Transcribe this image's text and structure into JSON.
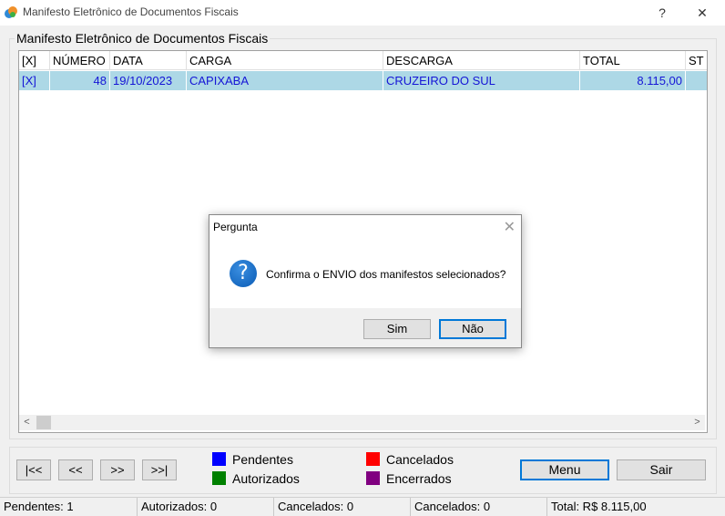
{
  "window": {
    "title": "Manifesto Eletrônico de Documentos Fiscais",
    "help_glyph": "?",
    "close_glyph": "✕"
  },
  "group": {
    "legend": "Manifesto Eletrônico de Documentos Fiscais"
  },
  "grid": {
    "columns": [
      "[X]",
      "NÚMERO",
      "DATA",
      "CARGA",
      "DESCARGA",
      "TOTAL",
      "ST"
    ],
    "rows": [
      {
        "sel": "[X]",
        "numero": "48",
        "data": "19/10/2023",
        "carga": "CAPIXABA",
        "descarga": "CRUZEIRO DO SUL",
        "total": "8.115,00",
        "st": ""
      }
    ],
    "scroll_left": "<",
    "scroll_right": ">"
  },
  "dialog": {
    "title": "Pergunta",
    "close_glyph": "✕",
    "icon": "question-icon",
    "icon_glyph": "?",
    "message": "Confirma o ENVIO dos manifestos selecionados?",
    "yes_label": "Sim",
    "no_label": "Não"
  },
  "nav": {
    "first": "|<<",
    "prev": "<<",
    "next": ">>",
    "last": ">>|"
  },
  "legend": {
    "pendentes": {
      "label": "Pendentes",
      "color": "#0000ff"
    },
    "autorizados": {
      "label": "Autorizados",
      "color": "#008000"
    },
    "cancelados": {
      "label": "Cancelados",
      "color": "#ff0000"
    },
    "encerrados": {
      "label": "Encerrados",
      "color": "#800080"
    }
  },
  "actions": {
    "menu": "Menu",
    "sair": "Sair"
  },
  "status": {
    "pendentes": "Pendentes: 1",
    "autorizados": "Autorizados: 0",
    "cancelados1": "Cancelados: 0",
    "cancelados2": "Cancelados: 0",
    "total": "Total: R$ 8.115,00"
  }
}
